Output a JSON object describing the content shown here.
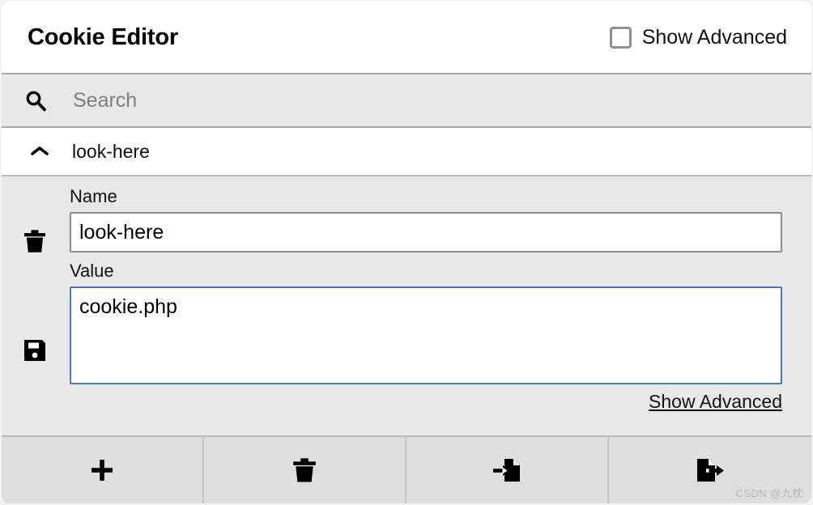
{
  "header": {
    "title": "Cookie Editor",
    "advanced_toggle_label": "Show Advanced",
    "checkbox_checked": false,
    "checkbox_icon": "checkbox-unchecked-icon"
  },
  "search": {
    "icon": "search-icon",
    "placeholder": "Search",
    "value": ""
  },
  "cookie_list": {
    "items": [
      {
        "name": "look-here",
        "expanded": true,
        "chevron_icon": "chevron-up-icon"
      }
    ]
  },
  "detail": {
    "delete_icon": "trash-icon",
    "save_icon": "floppy-disk-save-icon",
    "name_label": "Name",
    "name_value": "look-here",
    "value_label": "Value",
    "value_value": "cookie.php",
    "advanced_link_label": "Show Advanced",
    "focused_field": "value"
  },
  "toolbar": {
    "buttons": [
      {
        "name": "add-cookie-button",
        "icon": "plus-icon"
      },
      {
        "name": "delete-all-button",
        "icon": "trash-icon"
      },
      {
        "name": "import-cookies-button",
        "icon": "import-document-icon"
      },
      {
        "name": "export-cookies-button",
        "icon": "export-document-icon"
      }
    ]
  },
  "watermark": {
    "text": "CSDN @九枕"
  },
  "colors": {
    "accent_focus_border": "#4a79b8",
    "panel_background": "#e8e8e8",
    "toolbar_background": "#dedede",
    "input_border": "#8c8c8c",
    "checkbox_border": "#8d8d9c"
  }
}
